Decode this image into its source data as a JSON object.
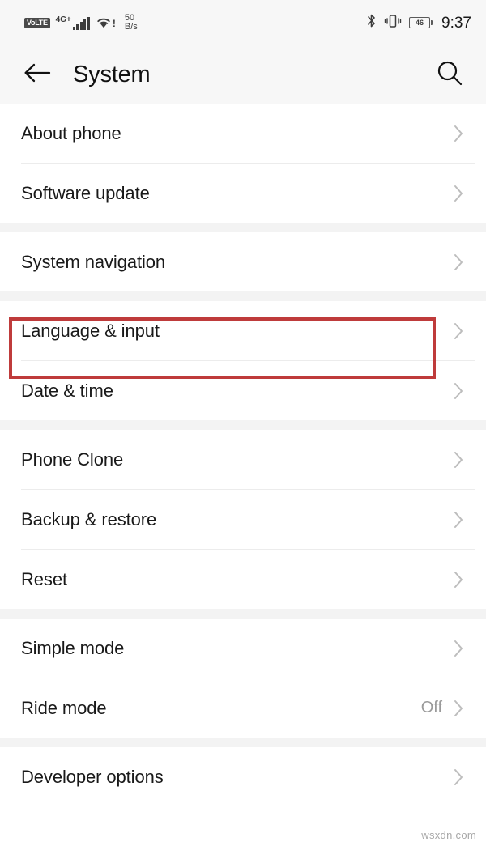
{
  "status_bar": {
    "volte_label": "VoLTE",
    "network_label": "4G+",
    "signal_bars": 5,
    "wifi_state": "wifi-exclamation",
    "net_speed_value": "50",
    "net_speed_unit": "B/s",
    "bluetooth": "bluetooth-icon",
    "vibrate": "vibrate-icon",
    "battery_percent": "46",
    "clock": "9:37"
  },
  "app_bar": {
    "back": "back-arrow-icon",
    "title": "System",
    "search": "search-icon"
  },
  "highlight": {
    "color": "#bf3b3b",
    "target_row": "Language & input"
  },
  "groups": [
    {
      "rows": [
        {
          "label": "About phone",
          "value": "",
          "chevron": true
        },
        {
          "label": "Software update",
          "value": "",
          "chevron": true
        }
      ]
    },
    {
      "rows": [
        {
          "label": "System navigation",
          "value": "",
          "chevron": true
        }
      ]
    },
    {
      "rows": [
        {
          "label": "Language & input",
          "value": "",
          "chevron": true,
          "highlighted": true
        },
        {
          "label": "Date & time",
          "value": "",
          "chevron": true
        }
      ]
    },
    {
      "rows": [
        {
          "label": "Phone Clone",
          "value": "",
          "chevron": true
        },
        {
          "label": "Backup & restore",
          "value": "",
          "chevron": true
        },
        {
          "label": "Reset",
          "value": "",
          "chevron": true
        }
      ]
    },
    {
      "rows": [
        {
          "label": "Simple mode",
          "value": "",
          "chevron": true
        },
        {
          "label": "Ride mode",
          "value": "Off",
          "chevron": true
        }
      ]
    },
    {
      "rows": [
        {
          "label": "Developer options",
          "value": "",
          "chevron": true
        }
      ]
    }
  ],
  "watermark": "wsxdn.com"
}
